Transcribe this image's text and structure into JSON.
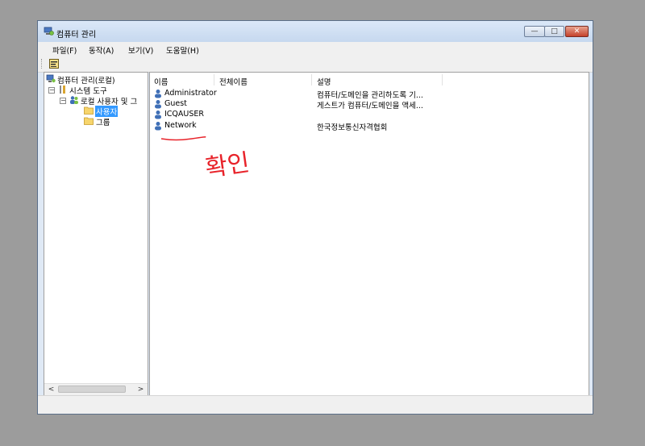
{
  "window": {
    "title": "컴퓨터 관리"
  },
  "titlebar_buttons": {
    "minimize": "—",
    "maximize": "□",
    "close": "✕"
  },
  "menu": [
    {
      "label": "파일(F)",
      "icon": "none"
    },
    {
      "label": "동작(A)",
      "icon": "none"
    },
    {
      "label": "보기(V)",
      "icon": "none"
    },
    {
      "label": "도움말(H)",
      "icon": "none"
    }
  ],
  "tree": {
    "root": "컴퓨터 관리(로컬)",
    "system_tools": "시스템 도구",
    "local_users": "로컬 사용자 및 그",
    "users": "사용자",
    "groups": "그룹"
  },
  "list": {
    "columns": [
      "이름",
      "전체이름",
      "설명"
    ],
    "rows": [
      {
        "name": "Administrator",
        "full_name": "",
        "description": "컴퓨터/도메인을 관리하도록 기..."
      },
      {
        "name": "Guest",
        "full_name": "",
        "description": "게스트가 컴퓨터/도메인을 액세..."
      },
      {
        "name": "ICQAUSER",
        "full_name": "",
        "description": ""
      },
      {
        "name": "Network",
        "full_name": "",
        "description": "한국정보통신자격협회"
      }
    ]
  },
  "scrollbar": {
    "left_arrow": "<",
    "right_arrow": ">"
  },
  "annotation": {
    "handwritten_text": "확인",
    "color": "#e8232a"
  },
  "colors": {
    "selection": "#3399ff",
    "titlebar": "#c6d8ef",
    "close_button": "#c5412b"
  }
}
